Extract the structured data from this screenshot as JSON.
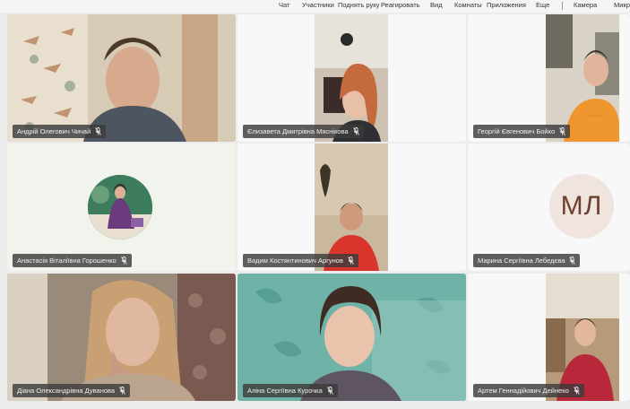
{
  "toolbar": {
    "chat": "Чат",
    "participants": "Участники",
    "raise_hand": "Поднять руку",
    "react": "Реагировать",
    "view": "Вид",
    "rooms": "Комнаты",
    "apps": "Приложения",
    "more": "Еще",
    "camera": "Камера",
    "mic": "Микр"
  },
  "participants": [
    {
      "name": "Андрій Олегович Чичай",
      "type": "video",
      "muted": true
    },
    {
      "name": "Єлизавета Дмитрівна Мяснікова",
      "type": "video",
      "muted": true
    },
    {
      "name": "Георгій Євгенович Бойко",
      "type": "video",
      "muted": true
    },
    {
      "name": "Анастасія Віталіївна Горошенко",
      "type": "avatar-photo",
      "muted": true
    },
    {
      "name": "Вадим Костянтинович Аргунов",
      "type": "video",
      "muted": true
    },
    {
      "name": "Марина Сергіївна Лебедєва",
      "type": "avatar-initials",
      "initials": "МЛ",
      "muted": true
    },
    {
      "name": "Діана Олександрівна Дуванова",
      "type": "video",
      "muted": true
    },
    {
      "name": "Аліна Сергіївна Курочка",
      "type": "video",
      "muted": true
    },
    {
      "name": "Артем Геннадійович Дейнеко",
      "type": "video",
      "muted": true
    }
  ],
  "colors": {
    "badge_bg": "#3c3c3c",
    "initials_bg": "#efe4de",
    "initials_fg": "#6d3f2f"
  }
}
